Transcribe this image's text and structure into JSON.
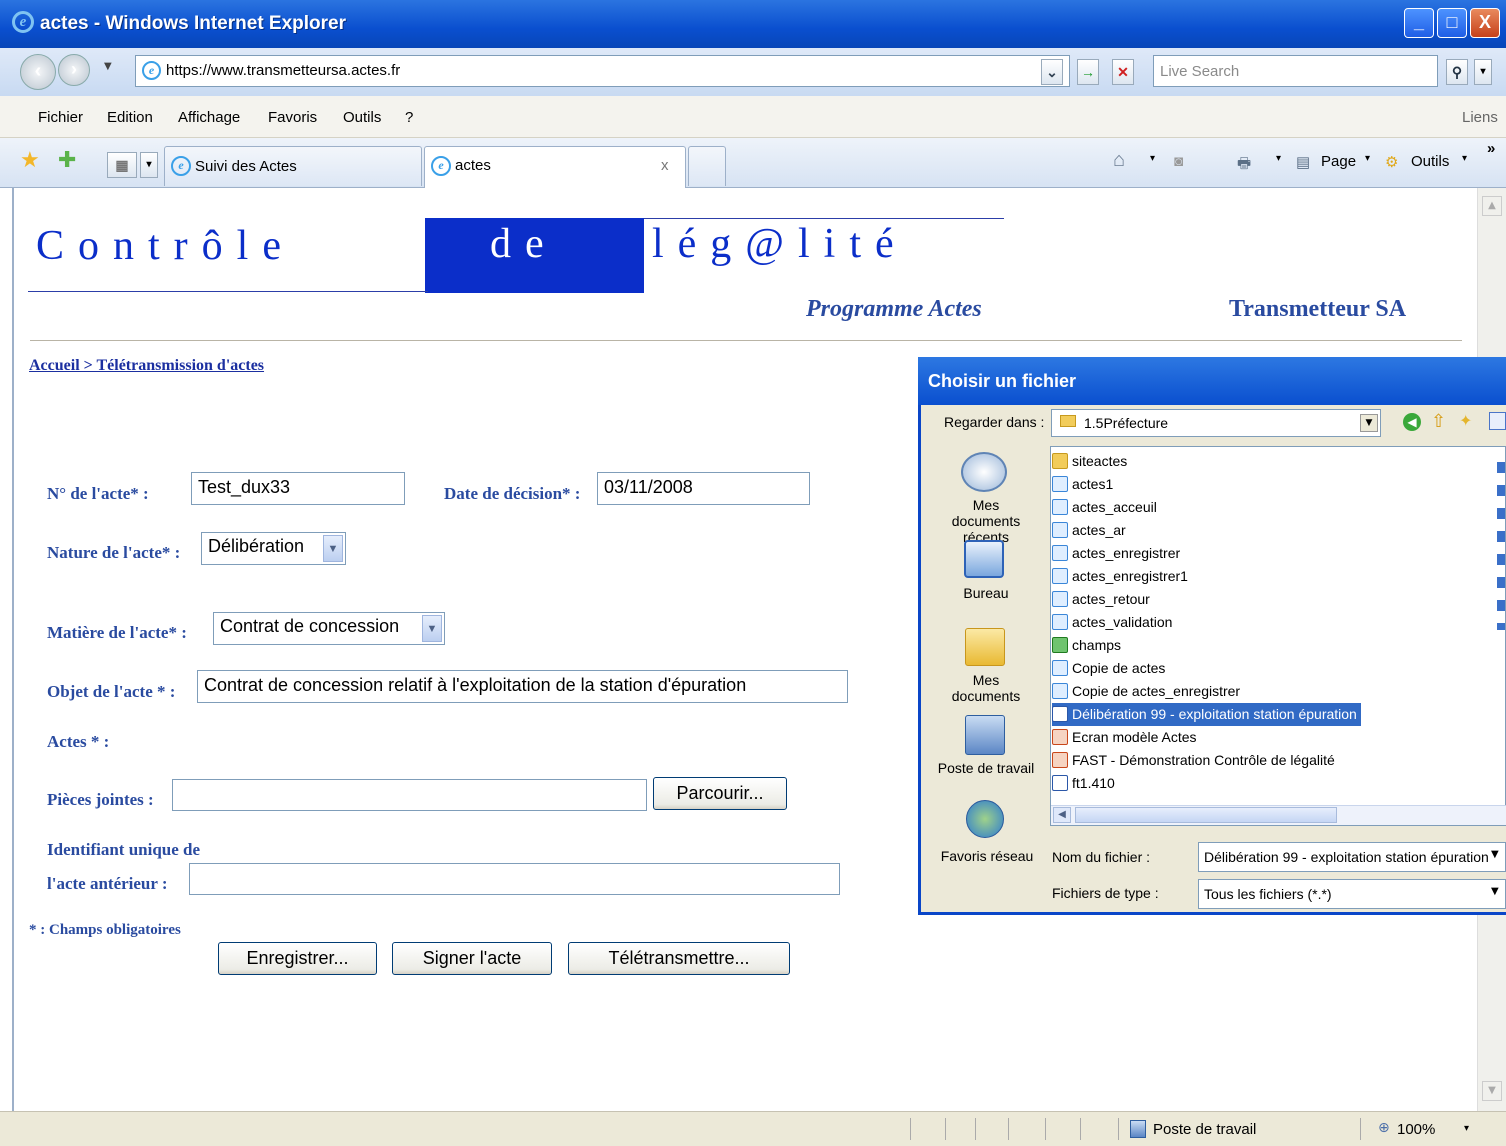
{
  "window": {
    "title": "actes - Windows Internet Explorer",
    "minimize": "_",
    "maximize": "□",
    "close": "X"
  },
  "address": {
    "url": "https://www.transmetteursa.actes.fr",
    "search_placeholder": "Live Search"
  },
  "menu": {
    "items": [
      "Fichier",
      "Edition",
      "Affichage",
      "Favoris",
      "Outils",
      "?"
    ],
    "links": "Liens"
  },
  "tabs": [
    {
      "label": "Suivi des Actes"
    },
    {
      "label": "actes"
    }
  ],
  "toolbar": {
    "page": "Page",
    "tools": "Outils",
    "tab_close": "x",
    "more": "»"
  },
  "header": {
    "title_part1": "Contrôle",
    "title_part2": "de",
    "title_part3": "lég@lité",
    "program": "Programme Actes",
    "company": "Transmetteur SA"
  },
  "breadcrumb": "Accueil > Télétransmission d'actes",
  "form": {
    "numero_label": "N° de l'acte* :",
    "numero_value": "Test_dux33",
    "date_label": "Date de décision* :",
    "date_value": "03/11/2008",
    "nature_label": "Nature de l'acte* :",
    "nature_value": "Délibération",
    "matiere_label": "Matière de l'acte* :",
    "matiere_value": "Contrat de concession",
    "objet_label": "Objet de l'acte * :",
    "objet_value": "Contrat de concession relatif à l'exploitation de la station d'épuration",
    "actes_label": "Actes * :",
    "pieces_label": "Pièces jointes :",
    "pieces_value": "",
    "browse_button": "Parcourir...",
    "identifiant_label1": "Identifiant unique de",
    "identifiant_label2": "l'acte antérieur :",
    "identifiant_value": "",
    "required_note": "* : Champs obligatoires",
    "save_button": "Enregistrer...",
    "sign_button": "Signer l'acte",
    "transmit_button": "Télétransmettre..."
  },
  "dialog": {
    "title": "Choisir un fichier",
    "look_in_label": "Regarder dans :",
    "look_in_value": "1.5Préfecture",
    "places": [
      "Mes documents récents",
      "Bureau",
      "Mes documents",
      "Poste de travail",
      "Favoris réseau"
    ],
    "files": [
      "siteactes",
      "actes1",
      "actes_acceuil",
      "actes_ar",
      "actes_enregistrer",
      "actes_enregistrer1",
      "actes_retour",
      "actes_validation",
      "champs",
      "Copie de actes",
      "Copie de actes_enregistrer",
      "Délibération 99 - exploitation station épuration",
      "Ecran modèle Actes",
      "FAST - Démonstration Contrôle de légalité",
      "ft1.410"
    ],
    "filename_label": "Nom du fichier :",
    "filename_value": "Délibération 99 - exploitation station épuration",
    "filetype_label": "Fichiers de type :",
    "filetype_value": "Tous les fichiers (*.*)"
  },
  "status": {
    "zone": "Poste de travail",
    "zoom": "100%"
  }
}
